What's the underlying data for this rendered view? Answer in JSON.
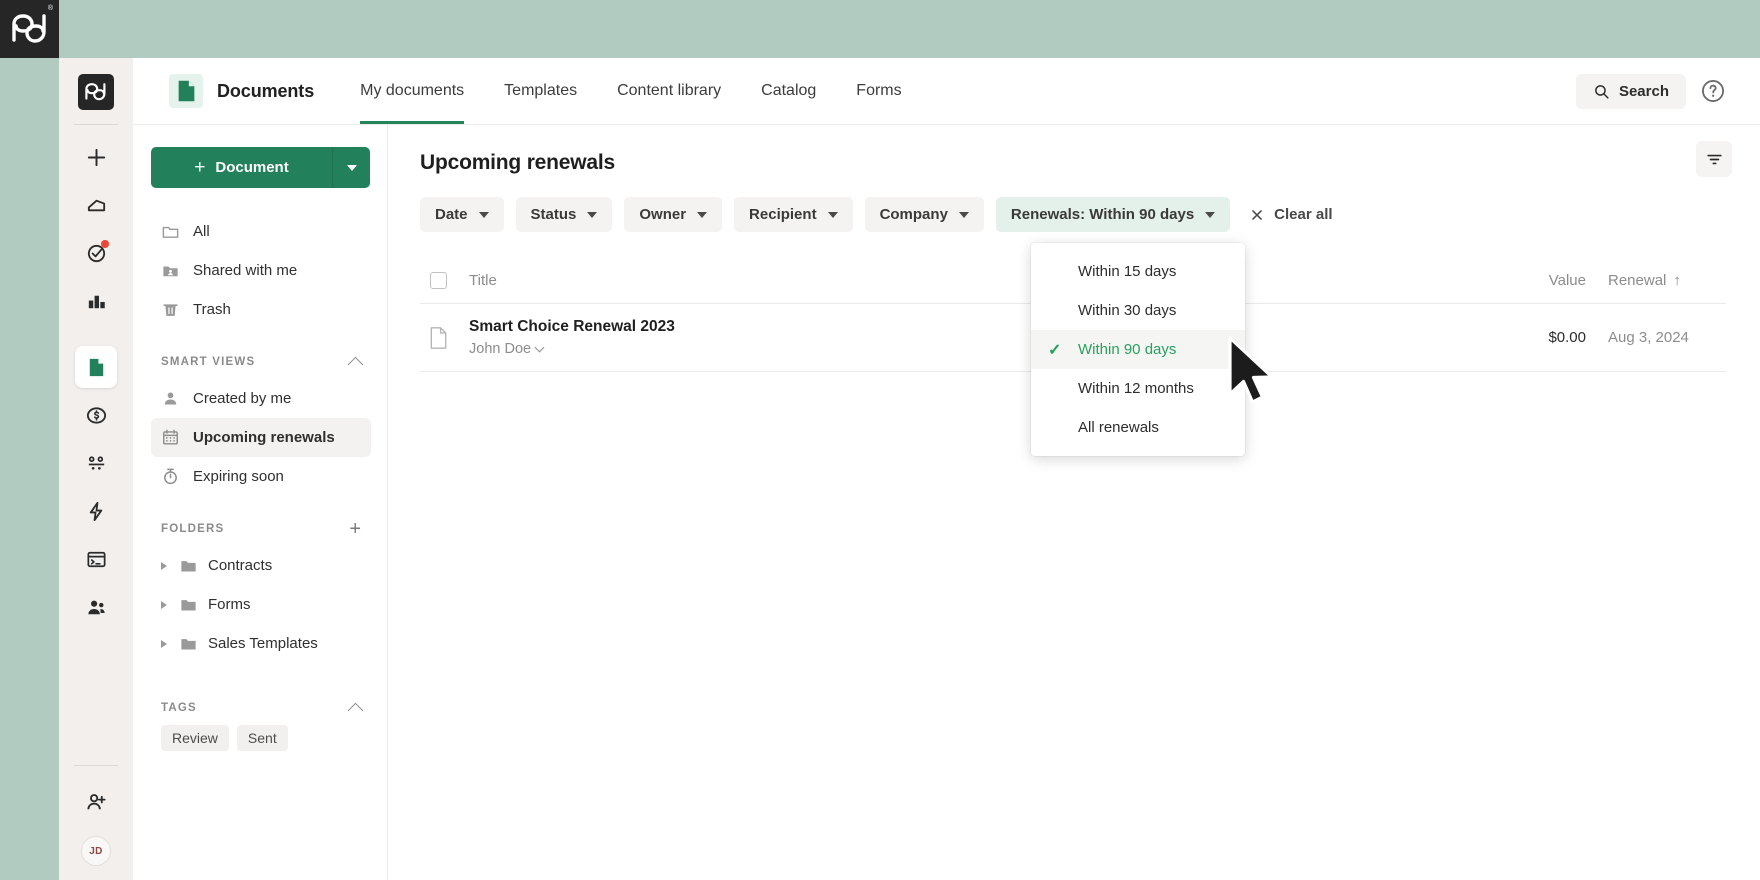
{
  "app": {
    "logo": "pandadoc-logo",
    "brand_title": "Documents"
  },
  "topbar": {
    "tabs": [
      {
        "label": "My documents",
        "active": true
      },
      {
        "label": "Templates",
        "active": false
      },
      {
        "label": "Content library",
        "active": false
      },
      {
        "label": "Catalog",
        "active": false
      },
      {
        "label": "Forms",
        "active": false
      }
    ],
    "search_label": "Search",
    "help_icon": "help-circle-icon",
    "search_icon": "search-icon"
  },
  "rail": {
    "icons": [
      "plus-icon",
      "home-icon",
      "tasks-icon",
      "reports-icon",
      "documents-icon",
      "quotes-icon",
      "pipeline-icon",
      "automation-icon",
      "workspace-icon",
      "contacts-icon"
    ],
    "bottom_icons": [
      "invite-user-icon"
    ],
    "avatar_initials": "JD"
  },
  "sidebar": {
    "create_button": {
      "label": "Document",
      "caret": "chevron-down-icon"
    },
    "items": [
      {
        "label": "All",
        "icon": "folder-outline-icon",
        "selected": false
      },
      {
        "label": "Shared with me",
        "icon": "folder-shared-icon",
        "selected": false
      },
      {
        "label": "Trash",
        "icon": "trash-icon",
        "selected": false
      }
    ],
    "smart_views": {
      "title": "SMART VIEWS",
      "items": [
        {
          "label": "Created by me",
          "icon": "person-icon",
          "selected": false
        },
        {
          "label": "Upcoming renewals",
          "icon": "calendar-icon",
          "selected": true
        },
        {
          "label": "Expiring soon",
          "icon": "stopwatch-icon",
          "selected": false
        }
      ]
    },
    "folders": {
      "title": "FOLDERS",
      "add_icon": "plus-icon",
      "items": [
        {
          "label": "Contracts"
        },
        {
          "label": "Forms"
        },
        {
          "label": "Sales Templates"
        }
      ]
    },
    "tags": {
      "title": "TAGS",
      "items": [
        "Review",
        "Sent"
      ]
    }
  },
  "main": {
    "page_title": "Upcoming renewals",
    "filter_icon": "filter-lines-icon",
    "filters": [
      {
        "label": "Date",
        "active": false
      },
      {
        "label": "Status",
        "active": false
      },
      {
        "label": "Owner",
        "active": false
      },
      {
        "label": "Recipient",
        "active": false
      },
      {
        "label": "Company",
        "active": false
      },
      {
        "label": "Renewals: Within 90 days",
        "active": true
      }
    ],
    "clear_all": "Clear all",
    "table": {
      "columns": {
        "title": "Title",
        "value": "Value",
        "renewal": "Renewal",
        "sort_arrow": "↑"
      },
      "rows": [
        {
          "title": "Smart Choice Renewal 2023",
          "owner": "John Doe",
          "value": "$0.00",
          "renewal": "Aug 3, 2024"
        }
      ]
    },
    "dropdown": {
      "items": [
        {
          "label": "Within 15 days",
          "selected": false
        },
        {
          "label": "Within 30 days",
          "selected": false
        },
        {
          "label": "Within 90 days",
          "selected": true
        },
        {
          "label": "Within 12 months",
          "selected": false
        },
        {
          "label": "All renewals",
          "selected": false
        }
      ],
      "check_glyph": "✓"
    }
  },
  "colors": {
    "page_backdrop": "#b2cbc0",
    "brand_green": "#22815a",
    "accent_green": "#2aa060",
    "rail_bg": "#f2efed",
    "dark": "#262626"
  }
}
